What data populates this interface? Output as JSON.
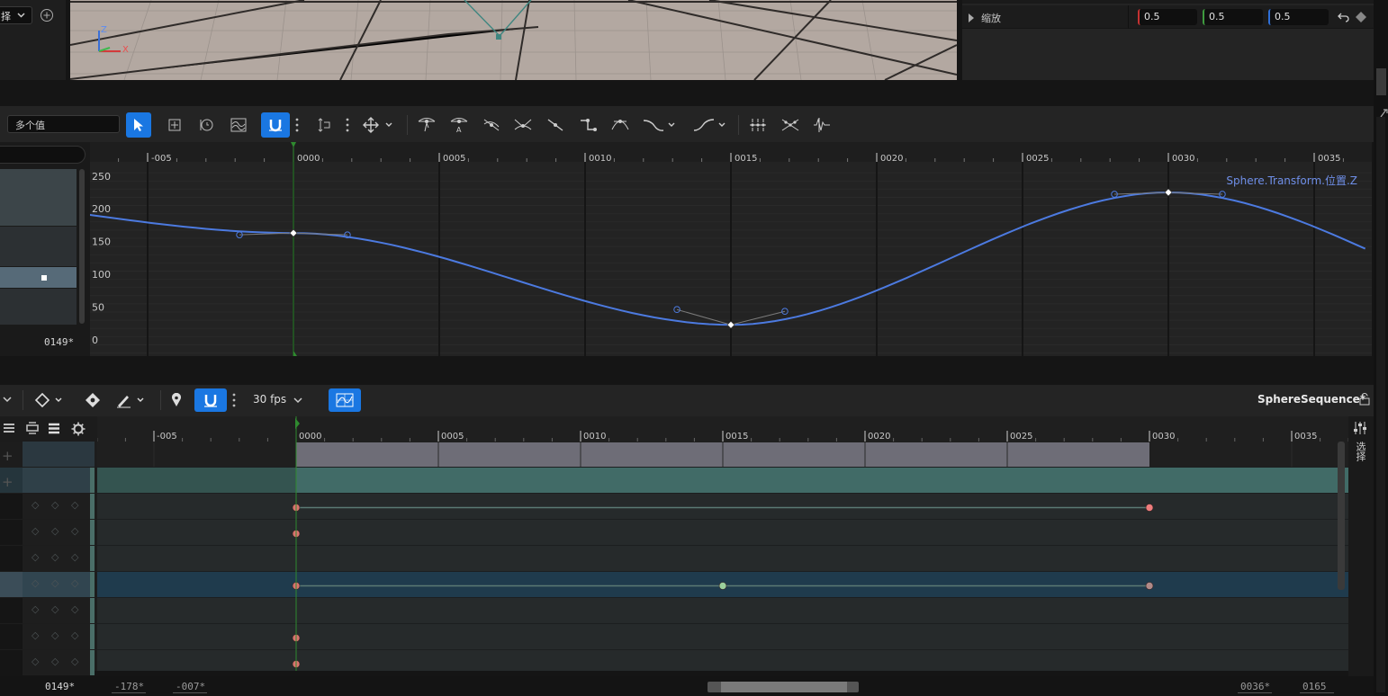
{
  "viewport": {
    "dropdown_label": "择",
    "axis_z": "Z",
    "axis_x": "X"
  },
  "details": {
    "scale_label": "缩放",
    "scale_x": "0.5",
    "scale_y": "0.5",
    "scale_z": "0.5"
  },
  "curve_editor": {
    "value_field": "多个值",
    "frame_display": "0149*",
    "curve_label": "Sphere.Transform.位置.Z",
    "ruler_ticks": [
      "-005",
      "0000",
      "0005",
      "0010",
      "0015",
      "0020",
      "0025",
      "0030",
      "0035"
    ],
    "y_ticks": [
      "250",
      "200",
      "150",
      "100",
      "50",
      "0"
    ]
  },
  "chart_data": {
    "type": "line",
    "title": "Sphere.Transform.位置.Z",
    "xlabel": "",
    "ylabel": "",
    "x_ticks": [
      -5,
      0,
      5,
      10,
      15,
      20,
      25,
      30,
      35
    ],
    "y_ticks": [
      0,
      50,
      100,
      150,
      200,
      250
    ],
    "xlim": [
      -7,
      37
    ],
    "ylim": [
      -20,
      265
    ],
    "series": [
      {
        "keyframes": [
          {
            "x": 0,
            "y": 163
          },
          {
            "x": 15,
            "y": 23
          },
          {
            "x": 30,
            "y": 225
          }
        ]
      }
    ]
  },
  "sequencer": {
    "fps_label": "30 fps",
    "sequence_name": "SphereSequence*",
    "ruler_ticks": [
      "-005",
      "0000",
      "0005",
      "0010",
      "0015",
      "0020",
      "0025",
      "0030",
      "0035"
    ],
    "side_label": "选择",
    "frame_current": "0149*",
    "range_start": "-178*",
    "range_view_start": "-007*",
    "range_view_end": "0036*",
    "range_end": "0165"
  },
  "colors": {
    "accent": "#1a77e2",
    "curve": "#4c7ae0",
    "key_red": "#d9746e",
    "key_green": "#9ccf9c",
    "section_bar": "#6e6d77",
    "track_teal": "#416b67",
    "selected_row": "#1f3b4d"
  }
}
